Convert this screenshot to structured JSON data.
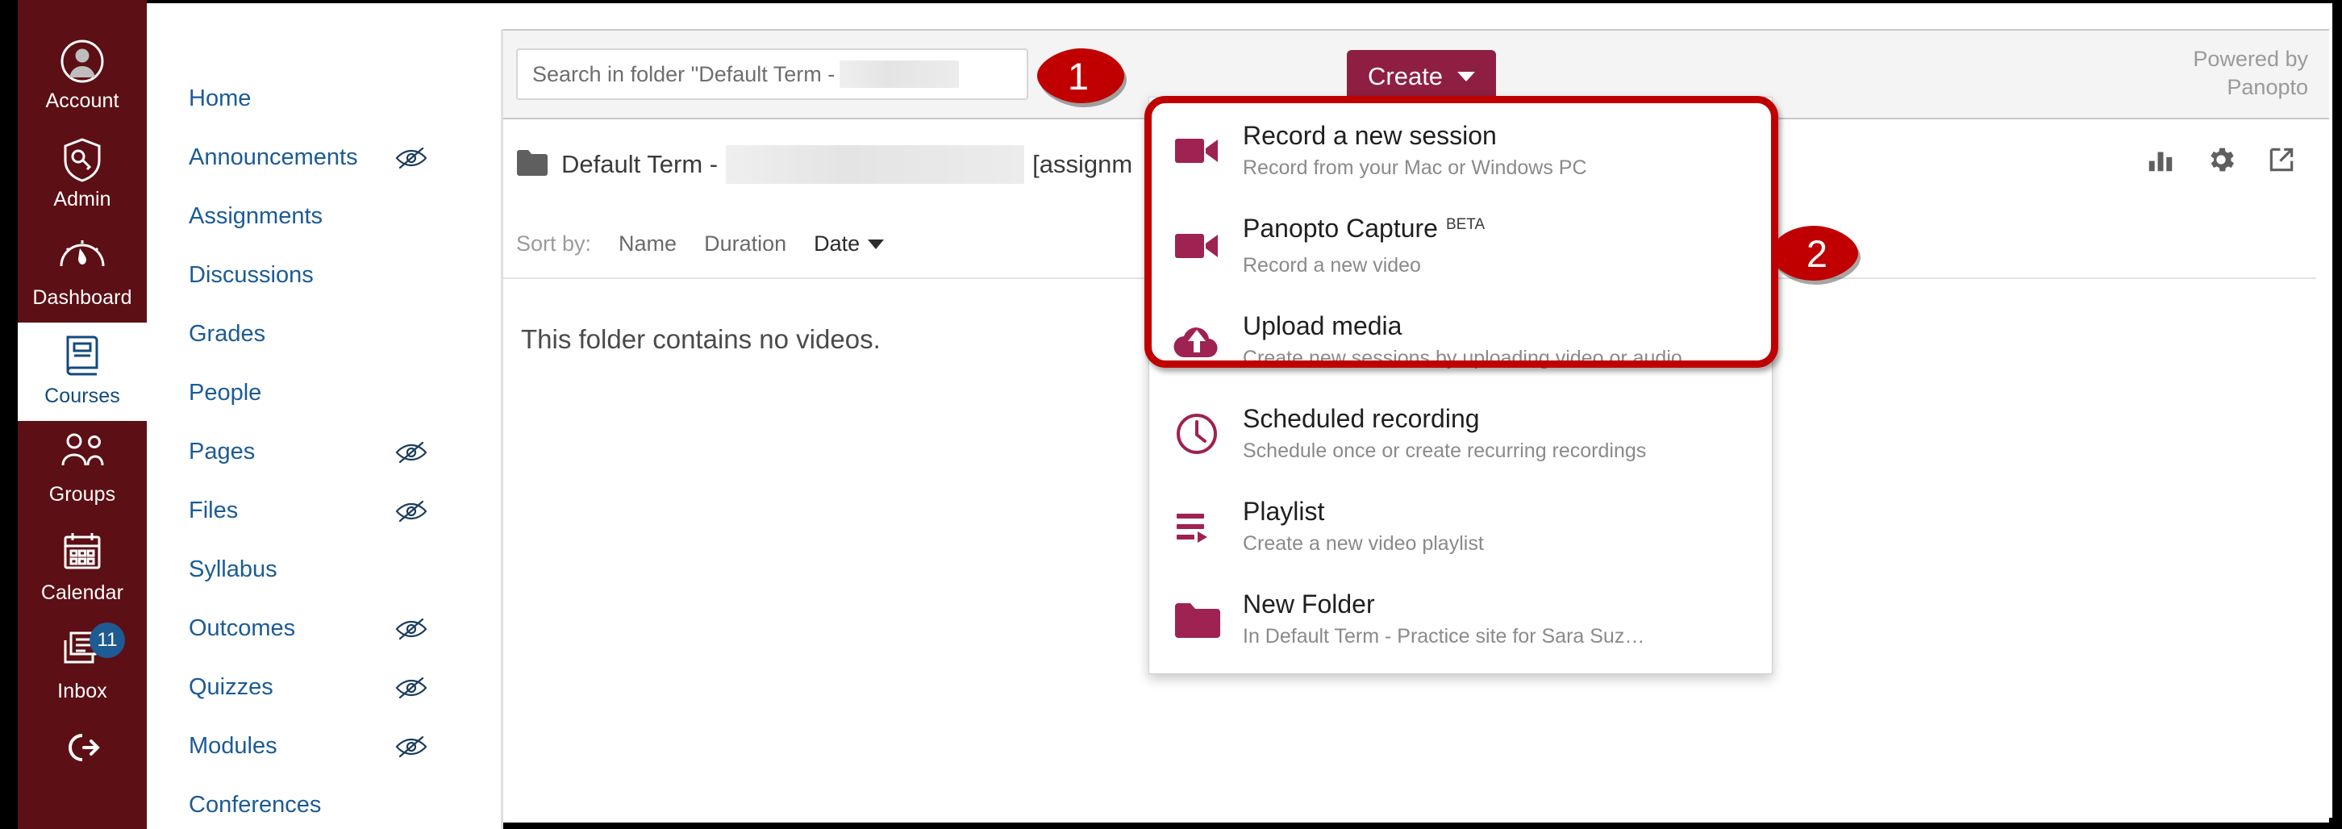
{
  "global_nav": {
    "items": [
      {
        "label": "Account",
        "icon": "account-avatar-icon",
        "active": false,
        "badge": null
      },
      {
        "label": "Admin",
        "icon": "shield-key-icon",
        "active": false,
        "badge": null
      },
      {
        "label": "Dashboard",
        "icon": "speedometer-icon",
        "active": false,
        "badge": null
      },
      {
        "label": "Courses",
        "icon": "book-icon",
        "active": true,
        "badge": null
      },
      {
        "label": "Groups",
        "icon": "people-icon",
        "active": false,
        "badge": null
      },
      {
        "label": "Calendar",
        "icon": "calendar-icon",
        "active": false,
        "badge": null
      },
      {
        "label": "Inbox",
        "icon": "inbox-icon",
        "active": false,
        "badge": "11"
      }
    ],
    "logout_icon": "logout-icon",
    "brand_color": "#5c0f14",
    "active_text_color": "#134a7c",
    "badge_color": "#1d5b92"
  },
  "course_nav": {
    "items": [
      {
        "label": "Home",
        "hidden_icon": false
      },
      {
        "label": "Announcements",
        "hidden_icon": true
      },
      {
        "label": "Assignments",
        "hidden_icon": false
      },
      {
        "label": "Discussions",
        "hidden_icon": false
      },
      {
        "label": "Grades",
        "hidden_icon": false
      },
      {
        "label": "People",
        "hidden_icon": false
      },
      {
        "label": "Pages",
        "hidden_icon": true
      },
      {
        "label": "Files",
        "hidden_icon": true
      },
      {
        "label": "Syllabus",
        "hidden_icon": false
      },
      {
        "label": "Outcomes",
        "hidden_icon": true
      },
      {
        "label": "Quizzes",
        "hidden_icon": true
      },
      {
        "label": "Modules",
        "hidden_icon": true
      },
      {
        "label": "Conferences",
        "hidden_icon": false
      }
    ],
    "link_color": "#1b5b96"
  },
  "panopto": {
    "search": {
      "value_prefix": "Search in folder \"Default Term -",
      "redacted": true
    },
    "create_button": {
      "label": "Create",
      "icon": "chevron-down-icon",
      "color": "#8e1f43"
    },
    "powered_by_line1": "Powered by",
    "powered_by_line2": "Panopto",
    "breadcrumb": {
      "folder_icon": "folder-icon",
      "prefix": "Default Term -",
      "suffix": "[assignm",
      "redacted": true
    },
    "header_actions": [
      {
        "name": "stats-icon",
        "label": "Stats"
      },
      {
        "name": "gear-icon",
        "label": "Settings"
      },
      {
        "name": "open-external-icon",
        "label": "Open in new window"
      }
    ],
    "sort": {
      "label": "Sort by:",
      "options": [
        "Name",
        "Duration",
        "Date"
      ],
      "active": "Date",
      "caret_icon": "caret-down-icon"
    },
    "empty_message": "This folder contains no videos."
  },
  "create_menu": {
    "items": [
      {
        "icon": "video-camera-icon",
        "title": "Record a new session",
        "badge": "",
        "subtitle": "Record from your Mac or Windows PC",
        "highlighted": true
      },
      {
        "icon": "video-camera-icon",
        "title": "Panopto Capture",
        "badge": "BETA",
        "subtitle": "Record a new video",
        "highlighted": true
      },
      {
        "icon": "cloud-upload-icon",
        "title": "Upload media",
        "badge": "",
        "subtitle": "Create new sessions by uploading video or audio",
        "highlighted": true
      },
      {
        "icon": "clock-icon",
        "title": "Scheduled recording",
        "badge": "",
        "subtitle": "Schedule once or create recurring recordings",
        "highlighted": false
      },
      {
        "icon": "playlist-icon",
        "title": "Playlist",
        "badge": "",
        "subtitle": "Create a new video playlist",
        "highlighted": false
      },
      {
        "icon": "folder-icon",
        "title": "New Folder",
        "badge": "",
        "subtitle": "In Default Term - Practice site for Sara Suz…",
        "highlighted": false
      }
    ],
    "highlight_color": "#c00000",
    "icon_color": "#9e2252"
  },
  "callouts": [
    {
      "number": "1",
      "direction": "right",
      "color": "#c00000"
    },
    {
      "number": "2",
      "direction": "left",
      "color": "#c00000"
    }
  ]
}
